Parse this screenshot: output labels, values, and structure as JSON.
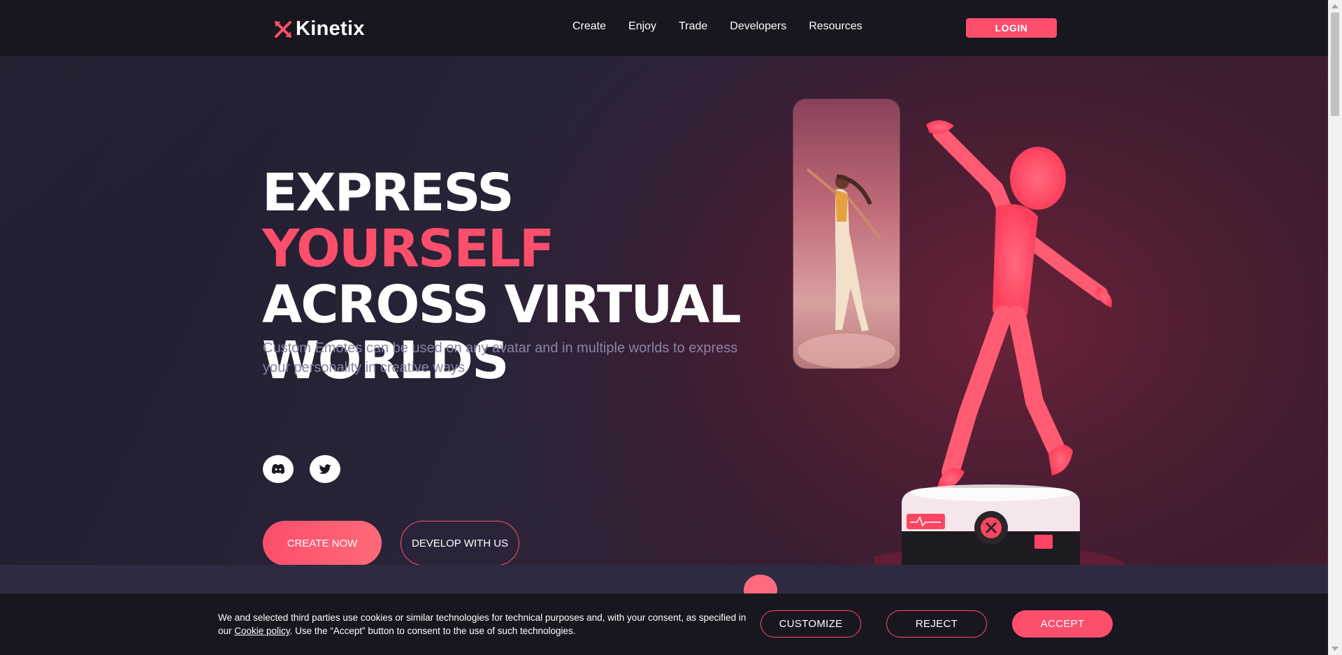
{
  "brand": {
    "name": "Kinetix",
    "accent": "#fd4e6c"
  },
  "nav": {
    "links": [
      "Create",
      "Enjoy",
      "Trade",
      "Developers",
      "Resources"
    ],
    "login_label": "LOGIN"
  },
  "hero": {
    "headline_line1_white": "EXPRESS",
    "headline_line1_accent": "YOURSELF",
    "headline_line2": "ACROSS VIRTUAL",
    "headline_line3": "WORLDS",
    "subtitle": "Custom Emotes can be used on any avatar and in multiple worlds to express your personality in creative ways.",
    "social_icons": [
      "discord-icon",
      "twitter-icon"
    ],
    "create_label": "CREATE NOW",
    "develop_label": "DEVELOP WITH US"
  },
  "cookie": {
    "text_before": "We and selected third parties use cookies or similar technologies for technical purposes and, with your consent, as specified in our ",
    "link": "Cookie policy",
    "text_after": ". Use the “Accept” button to consent to the use of such technologies.",
    "customize_label": "CUSTOMIZE",
    "reject_label": "REJECT",
    "accept_label": "ACCEPT"
  }
}
